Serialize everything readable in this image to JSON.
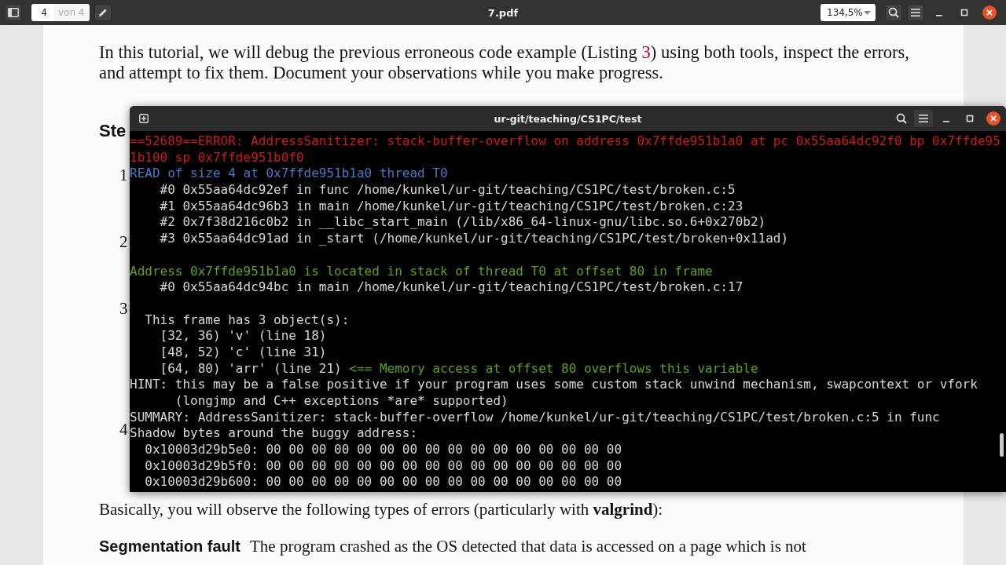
{
  "viewer": {
    "title": "7.pdf",
    "page_field": {
      "value": "4"
    },
    "page_total": "von 4",
    "zoom": "134,5%"
  },
  "document": {
    "paragraph": {
      "before": "In this tutorial, we will debug the previous erroneous code example (Listing ",
      "ref": "3",
      "after": ") using both tools, inspect the errors, and attempt to fix them. Document your observations while you make progress."
    },
    "heading": "Ste",
    "steps": [
      "1",
      "2",
      "3",
      "4"
    ],
    "summary": "Basically, you will observe the following types of errors (particularly with **valgrind**):",
    "definition": {
      "term": "Segmentation fault",
      "text": "The program crashed as the OS detected that data is accessed on a page which is not"
    }
  },
  "terminal": {
    "title": "ur-git/teaching/CS1PC/test",
    "lines": [
      {
        "kind": "text",
        "spans": [
          {
            "text": "==52689==ERROR: AddressSanitizer: stack-buffer-overflow on address 0x7ffde951b1a0 at pc 0x55aa64dc92f0 bp 0x7ffde95",
            "kind": "error"
          }
        ]
      },
      {
        "kind": "text",
        "spans": [
          {
            "text": "1b100 sp 0x7ffde951b0f0",
            "kind": "error"
          }
        ]
      },
      {
        "kind": "text",
        "spans": [
          {
            "text": "READ of size 4 at 0x7ffde951b1a0 thread T0",
            "kind": "access"
          }
        ]
      },
      {
        "kind": "text",
        "spans": [
          {
            "text": "    #0 0x55aa64dc92ef in func /home/kunkel/ur-git/teaching/CS1PC/test/broken.c:5",
            "kind": "normal"
          }
        ]
      },
      {
        "kind": "text",
        "spans": [
          {
            "text": "    #1 0x55aa64dc96b3 in main /home/kunkel/ur-git/teaching/CS1PC/test/broken.c:23",
            "kind": "normal"
          }
        ]
      },
      {
        "kind": "text",
        "spans": [
          {
            "text": "    #2 0x7f38d216c0b2 in __libc_start_main (/lib/x86_64-linux-gnu/libc.so.6+0x270b2)",
            "kind": "normal"
          }
        ]
      },
      {
        "kind": "text",
        "spans": [
          {
            "text": "    #3 0x55aa64dc91ad in _start (/home/kunkel/ur-git/teaching/CS1PC/test/broken+0x11ad)",
            "kind": "normal"
          }
        ]
      },
      {
        "kind": "blank"
      },
      {
        "kind": "text",
        "spans": [
          {
            "text": "Address 0x7ffde951b1a0 is located in stack of thread T0 at offset 80 in frame",
            "kind": "location"
          }
        ]
      },
      {
        "kind": "text",
        "spans": [
          {
            "text": "    #0 0x55aa64dc94bc in main /home/kunkel/ur-git/teaching/CS1PC/test/broken.c:17",
            "kind": "normal"
          }
        ]
      },
      {
        "kind": "blank"
      },
      {
        "kind": "text",
        "spans": [
          {
            "text": "  This frame has 3 object(s):",
            "kind": "normal"
          }
        ]
      },
      {
        "kind": "text",
        "spans": [
          {
            "text": "    [32, 36) 'v' (line 18)",
            "kind": "normal"
          }
        ]
      },
      {
        "kind": "text",
        "spans": [
          {
            "text": "    [48, 52) 'c' (line 31)",
            "kind": "normal"
          }
        ]
      },
      {
        "kind": "text",
        "spans": [
          {
            "text": "    [64, 80) 'arr' (line 21) ",
            "kind": "normal"
          },
          {
            "text": "<== Memory access at offset 80 overflows this variable",
            "kind": "location"
          }
        ]
      },
      {
        "kind": "text",
        "spans": [
          {
            "text": "HINT: this may be a false positive if your program uses some custom stack unwind mechanism, swapcontext or vfork",
            "kind": "normal"
          }
        ]
      },
      {
        "kind": "text",
        "spans": [
          {
            "text": "      (longjmp and C++ exceptions *are* supported)",
            "kind": "normal"
          }
        ]
      },
      {
        "kind": "text",
        "spans": [
          {
            "text": "SUMMARY: AddressSanitizer: stack-buffer-overflow /home/kunkel/ur-git/teaching/CS1PC/test/broken.c:5 in func",
            "kind": "normal"
          }
        ]
      },
      {
        "kind": "text",
        "spans": [
          {
            "text": "Shadow bytes around the buggy address:",
            "kind": "normal"
          }
        ]
      },
      {
        "kind": "text",
        "spans": [
          {
            "text": "  0x10003d29b5e0: 00 00 00 00 00 00 00 00 00 00 00 00 00 00 00 00",
            "kind": "normal"
          }
        ]
      },
      {
        "kind": "text",
        "spans": [
          {
            "text": "  0x10003d29b5f0: 00 00 00 00 00 00 00 00 00 00 00 00 00 00 00 00",
            "kind": "normal"
          }
        ]
      },
      {
        "kind": "text",
        "spans": [
          {
            "text": "  0x10003d29b600: 00 00 00 00 00 00 00 00 00 00 00 00 00 00 00 00",
            "kind": "normal"
          }
        ]
      }
    ]
  }
}
